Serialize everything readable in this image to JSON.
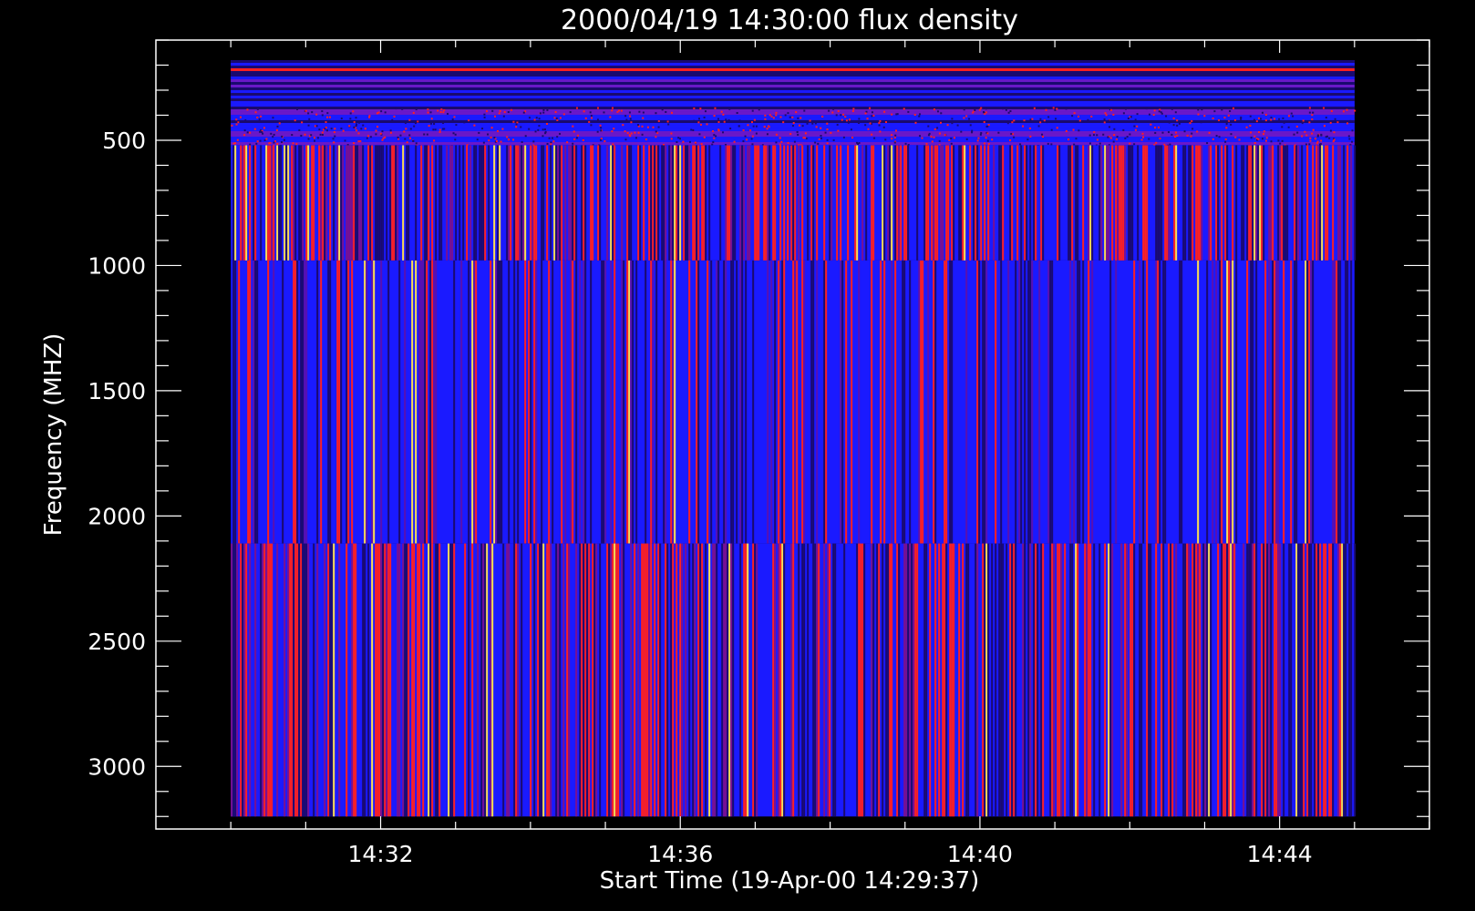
{
  "chart_data": {
    "type": "heatmap",
    "title": "2000/04/19 14:30:00 flux density",
    "xlabel": "Start Time (19-Apr-00 14:29:37)",
    "ylabel": "Frequency (MHZ)",
    "xticks": [
      "14:32",
      "14:36",
      "14:40",
      "14:44"
    ],
    "xtick_minutes": [
      2.383,
      6.383,
      10.383,
      14.383
    ],
    "xlim_minutes": [
      -0.617,
      16.383
    ],
    "data_x_range_minutes": [
      0.383,
      15.383
    ],
    "yticks": [
      500,
      1000,
      1500,
      2000,
      2500,
      3000
    ],
    "ylim": [
      3250,
      100
    ],
    "data_y_range": [
      180,
      3200
    ],
    "grid": false,
    "bands": [
      {
        "freq_range": [
          180,
          520
        ],
        "description": "noisy horizontal streaks",
        "dominant": "blue"
      },
      {
        "freq_range": [
          520,
          980
        ],
        "description": "vertical streaks",
        "dominant": "blue-red"
      },
      {
        "freq_range": [
          980,
          2110
        ],
        "description": "vertical streaks",
        "dominant": "blue"
      },
      {
        "freq_range": [
          2110,
          3200
        ],
        "description": "vertical streaks",
        "dominant": "blue-red"
      }
    ],
    "colors": {
      "background": "#000000",
      "low": "#1a0a6e",
      "mid": "#1a1aff",
      "high": "#ff2020",
      "peak": "#ffe050"
    }
  }
}
